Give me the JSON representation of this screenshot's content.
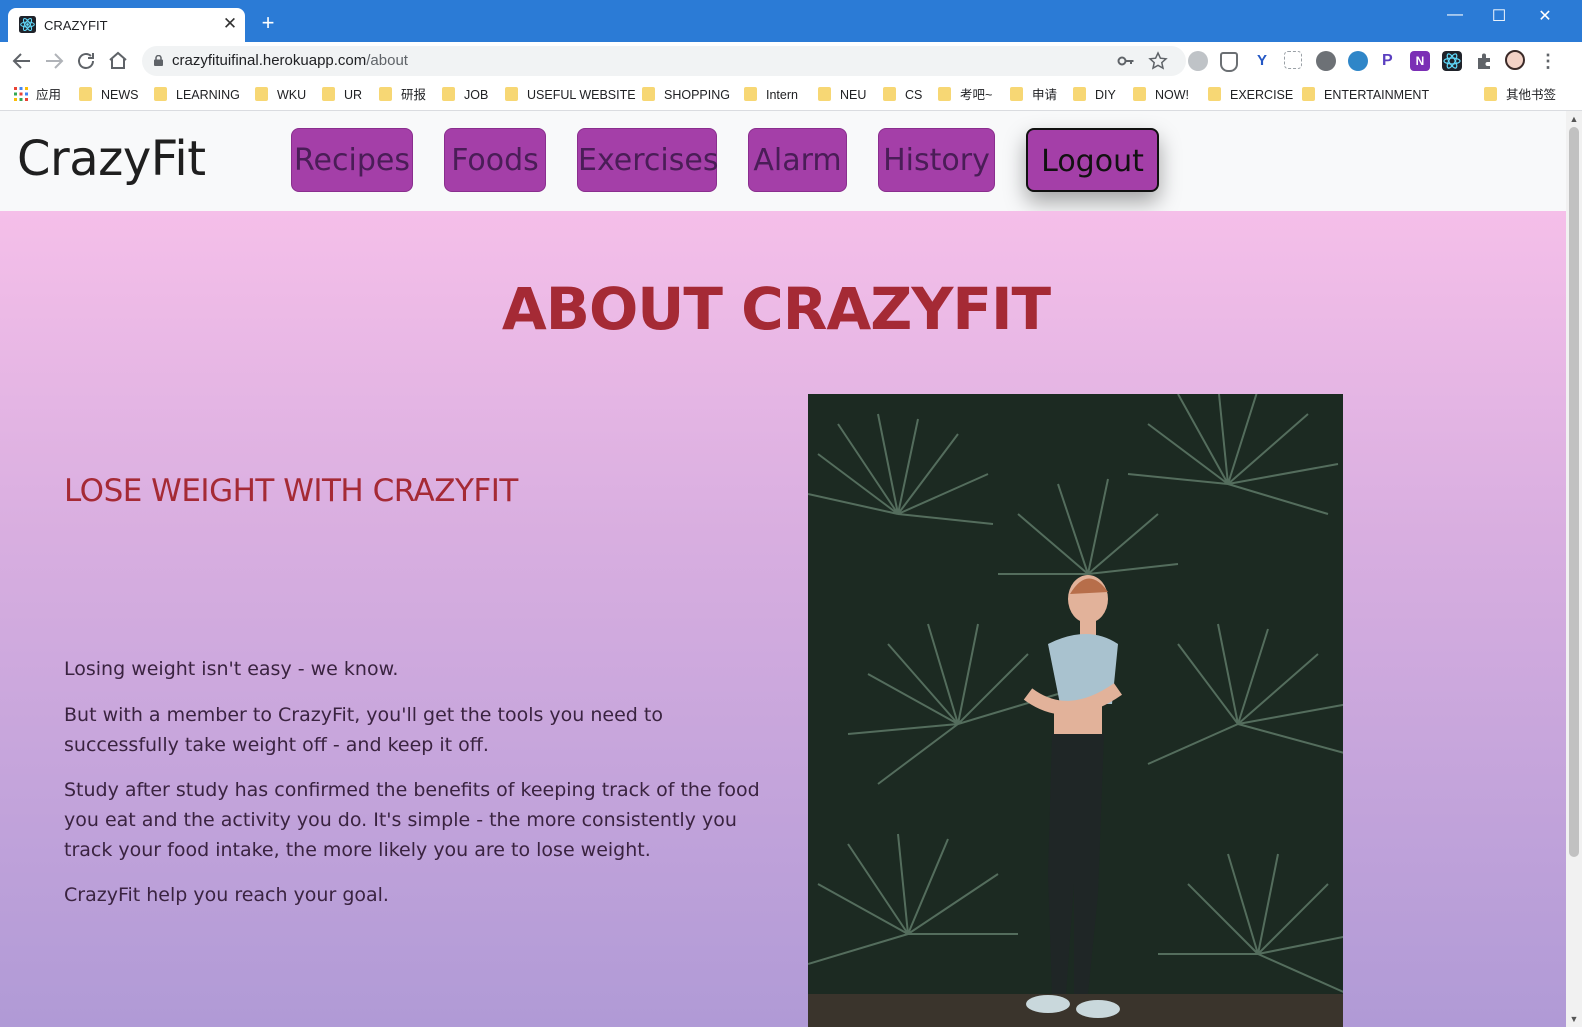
{
  "browser": {
    "tab_title": "CRAZYFIT",
    "tab_close": "✕",
    "new_tab": "+",
    "url_host": "crazyfituifinal.herokuapp.com",
    "url_path": "/about",
    "window_controls": [
      "—",
      "☐",
      "✕"
    ],
    "bookmarks": [
      "应用",
      "NEWS",
      "LEARNING",
      "WKU",
      "UR",
      "研报",
      "JOB",
      "USEFUL WEBSITE",
      "SHOPPING",
      "Intern",
      "NEU",
      "CS",
      "考吧~",
      "申请",
      "DIY",
      "NOW!",
      "EXERCISE",
      "ENTERTAINMENT",
      "其他书签"
    ]
  },
  "site": {
    "brand": "CrazyFit",
    "nav": [
      "Recipes",
      "Foods",
      "Exercises",
      "Alarm",
      "History",
      "Logout"
    ]
  },
  "about": {
    "title": "ABOUT CRAZYFIT",
    "subtitle": "LOSE WEIGHT WITH CRAZYFIT",
    "paragraphs": [
      "Losing weight isn't easy - we know.",
      "But with a member to CrazyFit, you'll get the tools you need to successfully take weight off - and keep it off.",
      "Study after study has confirmed the benefits of keeping track of the food you eat and the activity you do. It's simple - the more consistently you track your food intake, the more likely you are to lose weight.",
      "CrazyFit help you reach your goal."
    ]
  },
  "colors": {
    "chrome_blue": "#2b7bd6",
    "nav_button": "#a43fa8",
    "title_red": "#a52a35"
  }
}
